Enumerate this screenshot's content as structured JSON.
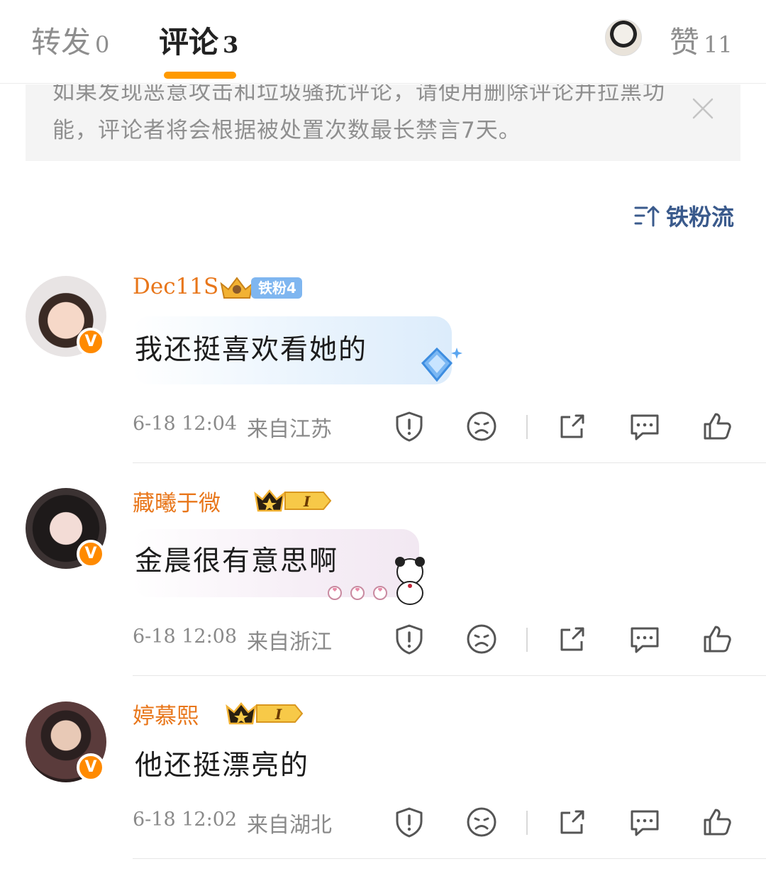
{
  "tabs": {
    "forward": {
      "label": "转发",
      "count": "0"
    },
    "comment": {
      "label": "评论",
      "count": "3"
    },
    "like": {
      "label": "赞",
      "count": "11"
    }
  },
  "notice": {
    "text": "如果发现恶意攻击和垃圾骚扰评论，请使用删除评论并拉黑功能，评论者将会根据被处置次数最长禁言7天。"
  },
  "sort": {
    "label": "铁粉流",
    "icon": "sort-icon"
  },
  "comments": [
    {
      "username": "Dec11S",
      "badge": "铁粉4",
      "text": "我还挺喜欢看她的",
      "time": "6-18 12:04",
      "location": "来自江苏",
      "verified": "V"
    },
    {
      "username": "藏曦于微",
      "badge": "I",
      "text": "金晨很有意思啊",
      "time": "6-18 12:08",
      "location": "来自浙江",
      "verified": "V"
    },
    {
      "username": "婷慕熙",
      "badge": "I",
      "text": "他还挺漂亮的",
      "time": "6-18 12:02",
      "location": "来自湖北",
      "verified": "V"
    }
  ],
  "colors": {
    "accent": "#ff9a00",
    "username": "#e8761a",
    "sort": "#3a5a8c"
  }
}
